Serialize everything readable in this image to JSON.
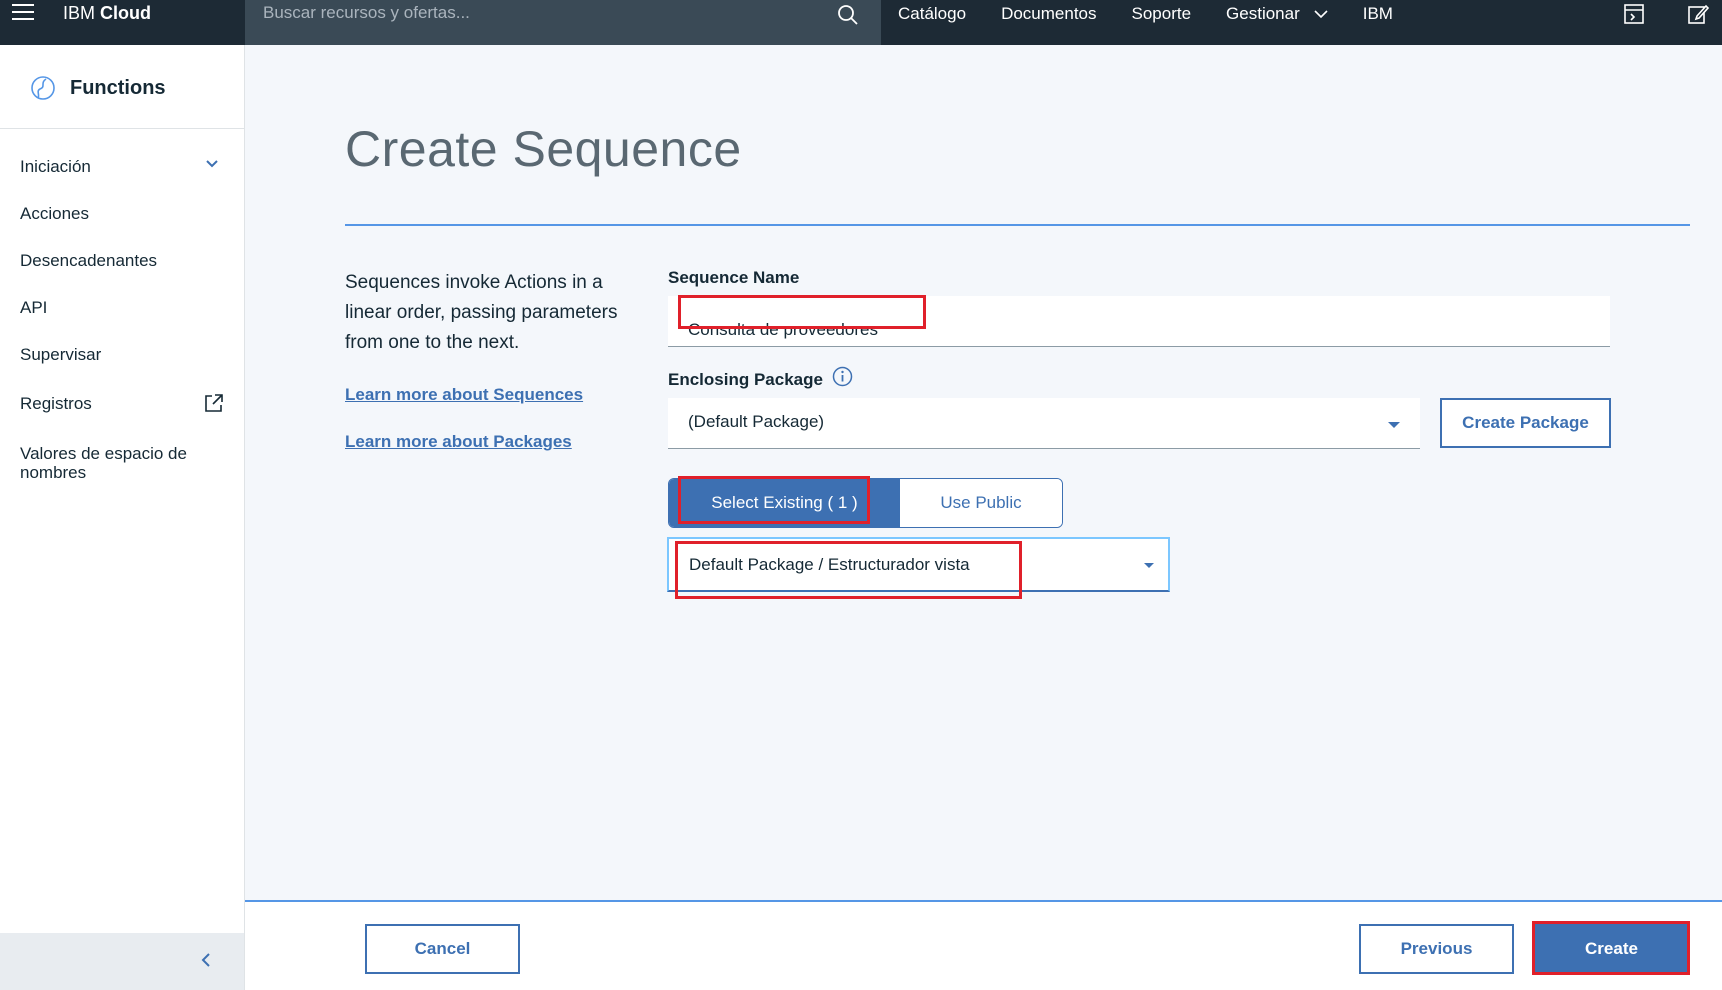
{
  "topbar": {
    "brand_prefix": "IBM",
    "brand_suffix": "Cloud",
    "search_placeholder": "Buscar recursos y ofertas...",
    "nav": [
      "Catálogo",
      "Documentos",
      "Soporte",
      "Gestionar",
      "IBM"
    ]
  },
  "sidebar": {
    "title": "Functions",
    "items": [
      "Iniciación",
      "Acciones",
      "Desencadenantes",
      "API",
      "Supervisar",
      "Registros",
      "Valores de espacio de nombres"
    ]
  },
  "main": {
    "title": "Create Sequence",
    "description": "Sequences invoke Actions in a linear order, passing parameters from one to the next.",
    "link_sequences": "Learn more about Sequences",
    "link_packages": "Learn more about Packages",
    "sequence_name_label": "Sequence Name",
    "sequence_name_value": "Consulta de proveedores",
    "enclosing_package_label": "Enclosing Package",
    "enclosing_package_value": "(Default Package)",
    "create_package_label": "Create Package",
    "toggle_select_existing": "Select Existing ( 1 )",
    "toggle_use_public": "Use Public",
    "action_select_value": "Default Package / Estructurador vista"
  },
  "footer": {
    "cancel_label": "Cancel",
    "previous_label": "Previous",
    "create_label": "Create"
  },
  "colors": {
    "topbar_bg": "#1d2a35",
    "accent": "#3d70b2",
    "highlight_annotation": "#e0202a"
  }
}
